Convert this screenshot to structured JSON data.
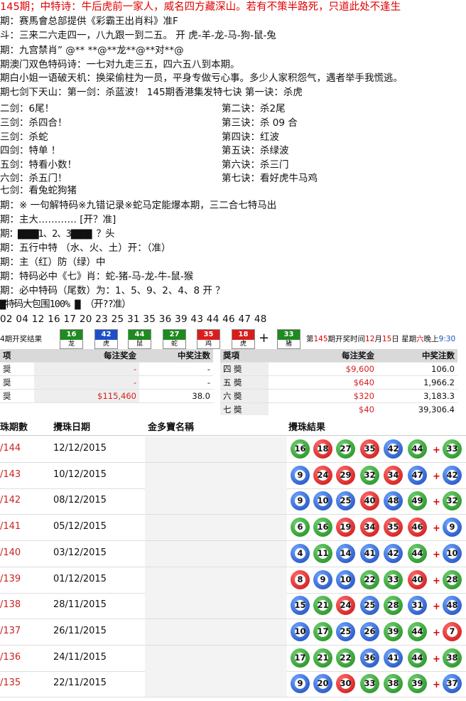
{
  "headline": "145期；中特诗：牛后虎前一家人，威名四方藏深山。若有不策半路死，只道此处不逢生",
  "lines": [
    "期：赛馬會总部提供《彩霸王出肖料》准F",
    "斗：三来二六走四一，八九跟一到二五。      开  虎-羊-龙-马-狗-鼠-兔",
    "期：九宫禁肖”  @** **@**龙**@**对**@",
    "期澳门双色特码诗：一七对九走三五，四六五八到本期。",
    "期白小姐一语破天机：换梁偷柱为一员，平身专做亏心事。多少人家积怨气，遇者举手我慌逃。",
    "期七剑下天山：第一剑：杀蓝波！       145期香港集发特七诀 第一诀：杀虎"
  ],
  "sword_pairs": [
    [
      "二剑：6尾！",
      "第二诀：杀2尾"
    ],
    [
      "三剑：杀四合！",
      "第三诀：杀 09 合"
    ],
    [
      "三剑：杀蛇",
      "第四诀：红波"
    ],
    [
      "四剑：特单 ！",
      "第五诀：杀绿波"
    ],
    [
      "五剑：特看小数！",
      "第六诀：杀三门"
    ],
    [
      "六剑：杀五门！",
      "第七诀：看好虎牛马鸡"
    ]
  ],
  "lines2": [
    "七剑：看兔蛇狗猪",
    "期：※ 一句解特码※九错记录※蛇马定能爆本期，三二合七特马出",
    "期：主大………… [开？准]",
    "期：▇▇▇▇1、2、3▇▇▇▇ ？头",
    "期：五行中特  （水、火、土）开：（准）",
    "期：主（红）防（绿）中",
    "期：特码必中《七》肖：蛇-猪-马-龙-牛-鼠-猴",
    "期：必中特码（尾数）为：1、5、9、2、4、8     开 ？",
    "▇特码大包围100% ▇   （开??准）",
    " 02 04 12 16 17 20 23 25 31 35 36 39 43 44 46 47 48"
  ],
  "draw": {
    "label": "4期开奖结果",
    "balls": [
      {
        "n": "16",
        "z": "龙",
        "c": "g"
      },
      {
        "n": "42",
        "z": "虎",
        "c": "b"
      },
      {
        "n": "44",
        "z": "鼠",
        "c": "g"
      },
      {
        "n": "27",
        "z": "蛇",
        "c": "g"
      },
      {
        "n": "35",
        "z": "鸡",
        "c": "r"
      },
      {
        "n": "18",
        "z": "虎",
        "c": "r"
      },
      {
        "n": "33",
        "z": "猪",
        "c": "g"
      }
    ],
    "plus": "+",
    "next_prefix": "第",
    "next_issue": "145",
    "next_mid": "期开奖时间",
    "next_month": "12",
    "next_month_unit": "月",
    "next_day": "15",
    "next_day_unit": "日 星期",
    "next_weekday": "六",
    "next_time_prefix": "晚上",
    "next_time": "9:30"
  },
  "prize_left": {
    "head": [
      "项",
      "每注奖金",
      "中奖注数"
    ],
    "rows": [
      [
        "奨",
        "-",
        "-"
      ],
      [
        "奨",
        "-",
        "-"
      ],
      [
        "奨",
        "$115,460",
        "38.0"
      ]
    ]
  },
  "prize_right": {
    "head": [
      "奨項",
      "每注奖金",
      "中奖注数"
    ],
    "rows": [
      [
        "四 奬",
        "$9,600",
        "106.0"
      ],
      [
        "五 奬",
        "$640",
        "1,966.2"
      ],
      [
        "六 奬",
        "$320",
        "3,183.3"
      ],
      [
        "七 奬",
        "$40",
        "39,306.4"
      ]
    ]
  },
  "history_head": [
    "珠期數",
    "攪珠日期",
    "金多寶名稱",
    "攪珠結果"
  ],
  "history": [
    {
      "no": "/144",
      "date": "12/12/2015",
      "balls": [
        [
          "16",
          "green"
        ],
        [
          "18",
          "red"
        ],
        [
          "27",
          "green"
        ],
        [
          "35",
          "red"
        ],
        [
          "42",
          "blue"
        ],
        [
          "44",
          "green"
        ]
      ],
      "sp": [
        "33",
        "green"
      ]
    },
    {
      "no": "/143",
      "date": "10/12/2015",
      "balls": [
        [
          "9",
          "blue"
        ],
        [
          "24",
          "red"
        ],
        [
          "29",
          "red"
        ],
        [
          "32",
          "green"
        ],
        [
          "34",
          "red"
        ],
        [
          "47",
          "blue"
        ]
      ],
      "sp": [
        "42",
        "blue"
      ]
    },
    {
      "no": "/142",
      "date": "08/12/2015",
      "balls": [
        [
          "9",
          "blue"
        ],
        [
          "10",
          "blue"
        ],
        [
          "25",
          "blue"
        ],
        [
          "40",
          "red"
        ],
        [
          "48",
          "blue"
        ],
        [
          "49",
          "green"
        ]
      ],
      "sp": [
        "32",
        "green"
      ]
    },
    {
      "no": "/141",
      "date": "05/12/2015",
      "balls": [
        [
          "6",
          "green"
        ],
        [
          "16",
          "green"
        ],
        [
          "19",
          "red"
        ],
        [
          "34",
          "red"
        ],
        [
          "35",
          "red"
        ],
        [
          "46",
          "red"
        ]
      ],
      "sp": [
        "9",
        "blue"
      ]
    },
    {
      "no": "/140",
      "date": "03/12/2015",
      "balls": [
        [
          "4",
          "blue"
        ],
        [
          "11",
          "green"
        ],
        [
          "14",
          "blue"
        ],
        [
          "41",
          "blue"
        ],
        [
          "42",
          "blue"
        ],
        [
          "44",
          "green"
        ]
      ],
      "sp": [
        "10",
        "blue"
      ]
    },
    {
      "no": "/139",
      "date": "01/12/2015",
      "balls": [
        [
          "8",
          "red"
        ],
        [
          "9",
          "blue"
        ],
        [
          "10",
          "blue"
        ],
        [
          "22",
          "green"
        ],
        [
          "33",
          "green"
        ],
        [
          "40",
          "red"
        ]
      ],
      "sp": [
        "28",
        "green"
      ]
    },
    {
      "no": "/138",
      "date": "28/11/2015",
      "balls": [
        [
          "15",
          "blue"
        ],
        [
          "21",
          "green"
        ],
        [
          "24",
          "red"
        ],
        [
          "25",
          "blue"
        ],
        [
          "28",
          "green"
        ],
        [
          "31",
          "blue"
        ]
      ],
      "sp": [
        "48",
        "blue"
      ]
    },
    {
      "no": "/137",
      "date": "26/11/2015",
      "balls": [
        [
          "10",
          "blue"
        ],
        [
          "17",
          "green"
        ],
        [
          "25",
          "blue"
        ],
        [
          "26",
          "blue"
        ],
        [
          "39",
          "green"
        ],
        [
          "44",
          "green"
        ]
      ],
      "sp": [
        "7",
        "red"
      ]
    },
    {
      "no": "/136",
      "date": "24/11/2015",
      "balls": [
        [
          "17",
          "green"
        ],
        [
          "21",
          "green"
        ],
        [
          "22",
          "green"
        ],
        [
          "36",
          "blue"
        ],
        [
          "41",
          "blue"
        ],
        [
          "44",
          "green"
        ]
      ],
      "sp": [
        "38",
        "green"
      ]
    },
    {
      "no": "/135",
      "date": "22/11/2015",
      "balls": [
        [
          "9",
          "blue"
        ],
        [
          "20",
          "blue"
        ],
        [
          "30",
          "red"
        ],
        [
          "33",
          "green"
        ],
        [
          "38",
          "green"
        ],
        [
          "39",
          "green"
        ]
      ],
      "sp": [
        "37",
        "blue"
      ]
    }
  ]
}
